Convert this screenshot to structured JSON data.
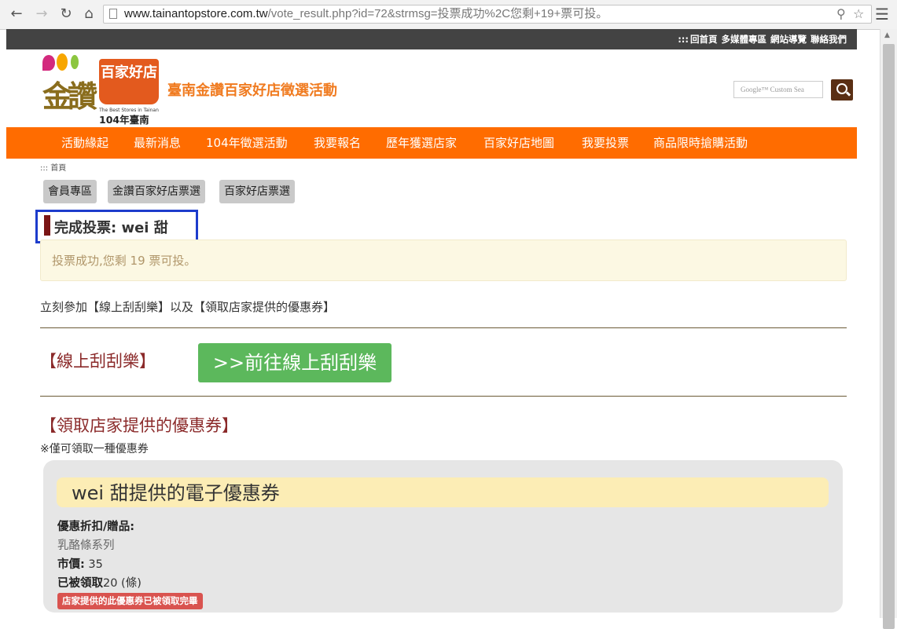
{
  "browser": {
    "url_host": "www.tainantopstore.com.tw",
    "url_path": "/vote_result.php?id=72&strmsg=投票成功%2C您剩+19+票可投。"
  },
  "topbar": {
    "links": [
      ":::",
      "回首頁",
      "多媒體專區",
      "網站導覽",
      "聯絡我們"
    ]
  },
  "logo": {
    "badge_text": "百家好店",
    "badge_sub": "The Best Stores in Tainan",
    "brush_text": "金讚",
    "year_text": "104年臺南"
  },
  "site_title": "臺南金讚百家好店徵選活動",
  "search": {
    "placeholder": "Google™ Custom Sea"
  },
  "nav": {
    "items": [
      "活動緣起",
      "最新消息",
      "104年徵選活動",
      "我要報名",
      "歷年獲選店家",
      "百家好店地圖",
      "我要投票",
      "商品限時搶購活動"
    ]
  },
  "breadcrumb": "::: 首頁",
  "tabs": [
    "會員專區",
    "金讚百家好店票選",
    "百家好店票選"
  ],
  "heading": "完成投票: wei 甜",
  "alert": "投票成功,您剩 19 票可投。",
  "intro": "立刻參加【線上刮刮樂】以及【領取店家提供的優惠券】",
  "scratch": {
    "title": "【線上刮刮樂】",
    "button": ">>前往線上刮刮樂"
  },
  "coupon_section": {
    "title": "【領取店家提供的優惠券】",
    "note": "※僅可領取一種優惠券"
  },
  "coupon": {
    "header": "wei 甜提供的電子優惠券",
    "discount_label": "優惠折扣/贈品:",
    "discount_value": "乳酪條系列",
    "price_label": "市價:",
    "price_value": "35",
    "claimed_label": "已被領取",
    "claimed_value": "20 (條)",
    "status_badge": "店家提供的此優惠券已被領取完畢"
  },
  "colors": {
    "nav_bg": "#ff6c00",
    "topbar_bg": "#434343",
    "title_orange": "#f07b20",
    "green_button": "#5cb85c",
    "highlight_border": "#1d3ccc",
    "badge_red": "#d9534f"
  }
}
